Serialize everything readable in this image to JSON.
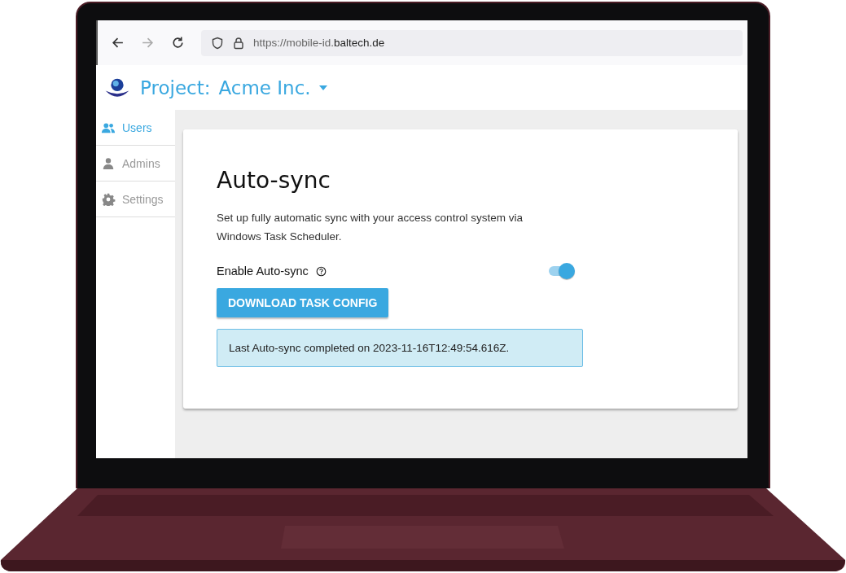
{
  "browser": {
    "url": "https://mobile-id.**baltech.de**"
  },
  "header": {
    "label": "Project:",
    "project": "Acme Inc."
  },
  "sidebar": {
    "items": [
      {
        "label": "Users",
        "kind": "users",
        "selected": true
      },
      {
        "label": "Admins",
        "kind": "admin",
        "selected": false
      },
      {
        "label": "Settings",
        "kind": "gear",
        "selected": false
      }
    ]
  },
  "card": {
    "title": "Auto-sync",
    "description": "Set up fully automatic sync with your access control system via Windows Task Scheduler.",
    "toggle": {
      "label": "Enable Auto-sync",
      "on": true
    },
    "button": "DOWNLOAD TASK CONFIG",
    "status": "Last Auto-sync completed on 2023-11-16T12:49:54.616Z."
  }
}
